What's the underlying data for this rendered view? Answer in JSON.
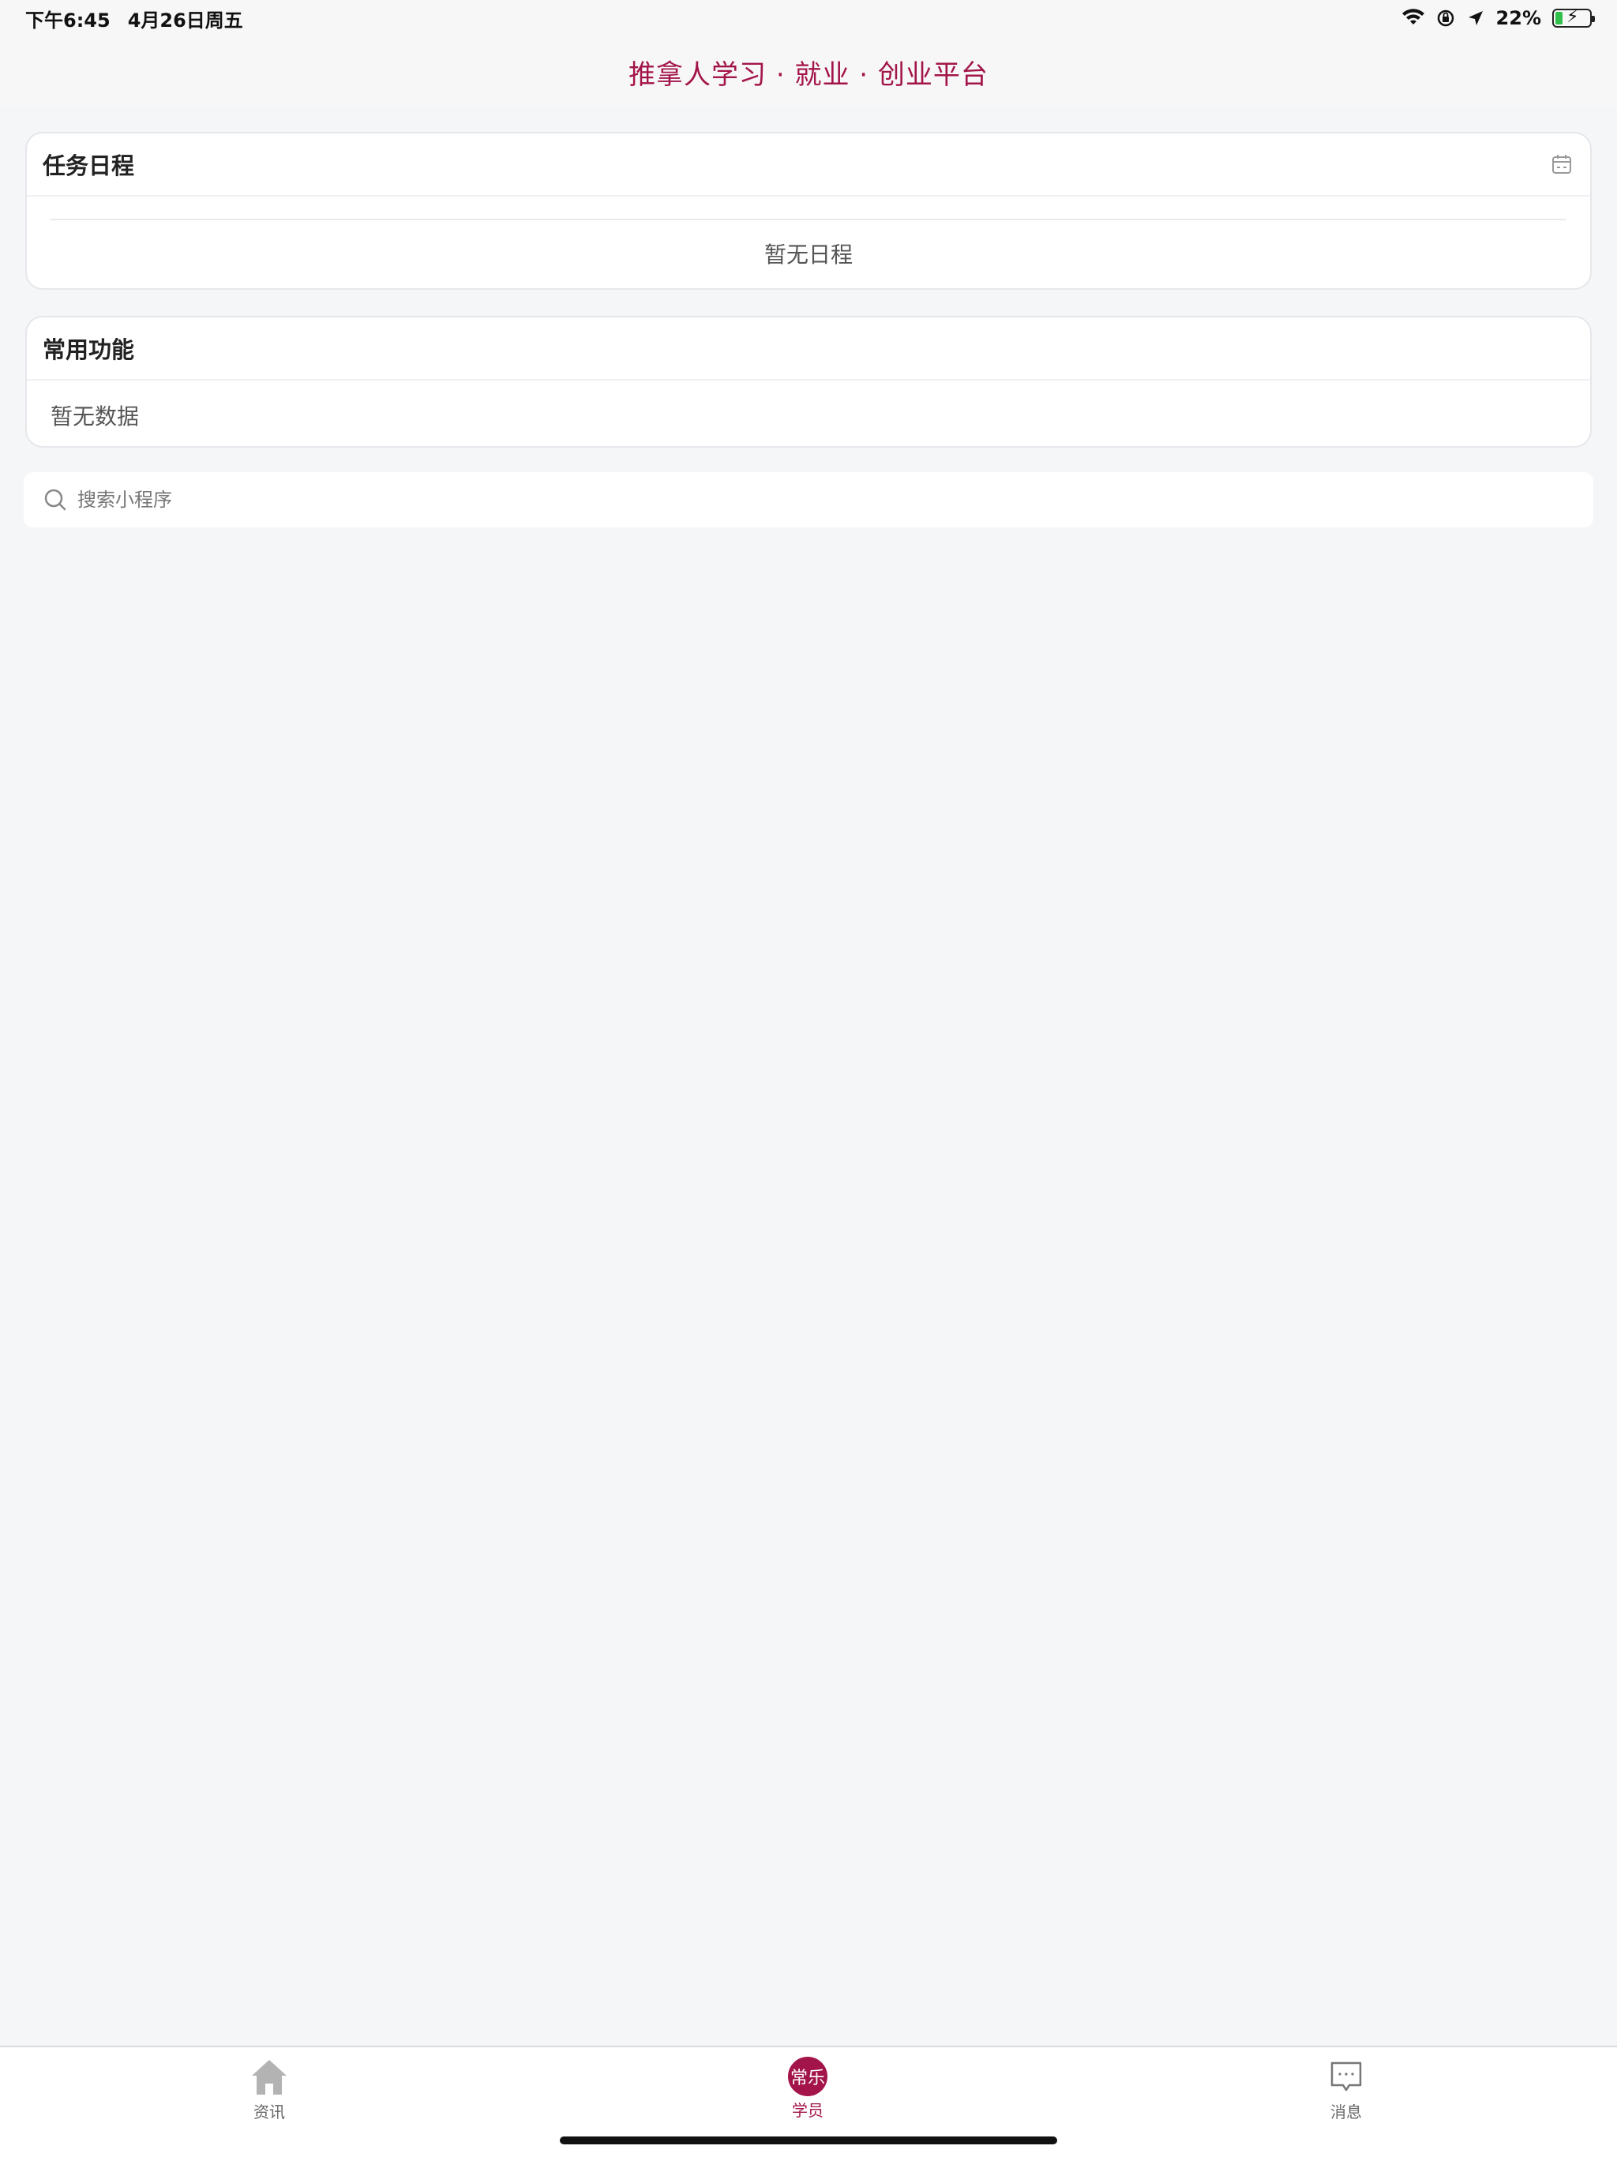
{
  "status_bar": {
    "time": "下午6:45",
    "date": "4月26日周五",
    "battery_percent_label": "22%",
    "battery_level": 0.22
  },
  "header": {
    "title": "推拿人学习 · 就业 · 创业平台"
  },
  "schedule_card": {
    "title": "任务日程",
    "empty_text": "暂无日程"
  },
  "functions_card": {
    "title": "常用功能",
    "empty_text": "暂无数据"
  },
  "search": {
    "placeholder": "搜索小程序"
  },
  "tab_bar": {
    "tabs": [
      {
        "label": "资讯",
        "icon": "home-icon"
      },
      {
        "label": "学员",
        "icon": "student-logo-icon",
        "badge_text": "常乐"
      },
      {
        "label": "消息",
        "icon": "chat-bubble-icon"
      }
    ],
    "active_tab": "学员"
  },
  "colors": {
    "brand": "#a3154a",
    "background": "#f5f6f8",
    "card": "#ffffff",
    "battery_green": "#2fbf4a"
  }
}
